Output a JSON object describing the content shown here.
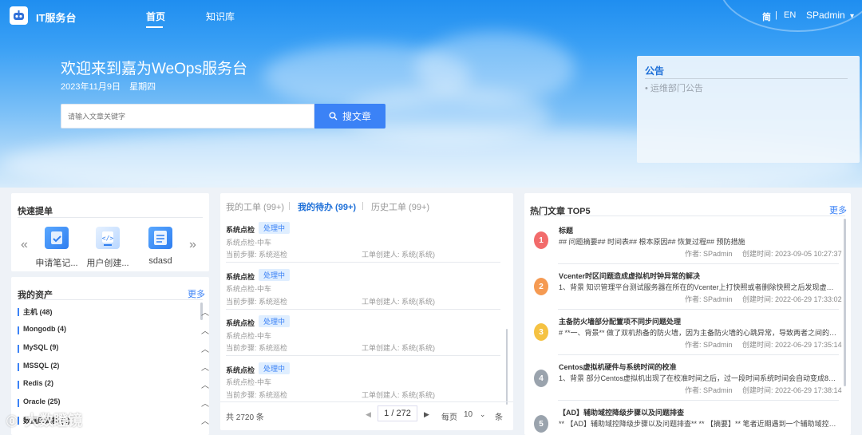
{
  "app": {
    "title": "IT服务台"
  },
  "nav": {
    "items": [
      {
        "label": "首页"
      },
      {
        "label": "知识库"
      }
    ]
  },
  "lang": {
    "zh": "简",
    "sep": "|",
    "en": "EN"
  },
  "user": {
    "name": "SPadmin",
    "caret": "▾"
  },
  "hero": {
    "welcome": "欢迎来到嘉为WeOps服务台",
    "date": "2023年11月9日",
    "weekday": "星期四",
    "search_placeholder": "请输入文章关键字",
    "search_button": "搜文章"
  },
  "notice": {
    "title": "公告",
    "items": [
      "• 运维部门公告"
    ]
  },
  "quick": {
    "title": "快速提单",
    "prev": "«",
    "next": "»",
    "items": [
      {
        "label": "申请笔记..."
      },
      {
        "label": "用户创建..."
      },
      {
        "label": "sdasd"
      }
    ]
  },
  "assets": {
    "title": "我的资产",
    "more": "更多",
    "items": [
      {
        "label": "主机 (48)"
      },
      {
        "label": "Mongodb (4)"
      },
      {
        "label": "MySQL (9)"
      },
      {
        "label": "MSSQL (2)"
      },
      {
        "label": "Redis (2)"
      },
      {
        "label": "Oracle (25)"
      },
      {
        "label": "数据库集群 (1)"
      }
    ]
  },
  "tasks": {
    "tabs": [
      {
        "label": "我的工单 (99+)"
      },
      {
        "label": "我的待办 (99+)"
      },
      {
        "label": "历史工单 (99+)"
      }
    ],
    "items": [
      {
        "name": "系统点检",
        "status": "处理中",
        "type": "系统点检-中车",
        "step": "当前步骤: 系统巡检",
        "creator": "工单创建人: 系统(系统)"
      },
      {
        "name": "系统点检",
        "status": "处理中",
        "type": "系统点检-中车",
        "step": "当前步骤: 系统巡检",
        "creator": "工单创建人: 系统(系统)"
      },
      {
        "name": "系统点检",
        "status": "处理中",
        "type": "系统点检-中车",
        "step": "当前步骤: 系统巡检",
        "creator": "工单创建人: 系统(系统)"
      },
      {
        "name": "系统点检",
        "status": "处理中",
        "type": "系统点检-中车",
        "step": "当前步骤: 系统巡检",
        "creator": "工单创建人: 系统(系统)"
      }
    ],
    "pager": {
      "total": "共 2720 条",
      "prev": "◀",
      "page": "1 / 272",
      "next": "▶",
      "per_page_label": "每页",
      "per_page": "10",
      "unit": "条"
    }
  },
  "hot": {
    "title": "热门文章 TOP5",
    "more": "更多",
    "items": [
      {
        "rank": "1",
        "title": "标题",
        "desc": "## 问题摘要## 时间表## 根本原因## 恢复过程## 预防措施",
        "author": "作者: SPadmin",
        "time": "创建时间: 2023-09-05 10:27:37",
        "color": "#f26b6b"
      },
      {
        "rank": "2",
        "title": "Vcenter时区问题造成虚拟机时钟异常的解决",
        "desc": "1、背景 知识管理平台测试服务器在所在的Vcenter上打快照或者删除快照之后发现虚拟机系...",
        "author": "作者: SPadmin",
        "time": "创建时间: 2022-06-29 17:33:02",
        "color": "#f59a52"
      },
      {
        "rank": "3",
        "title": "主备防火墙部分配置项不同步问题处理",
        "desc": "# **一、背景** 做了双机热备的防火墙，因为主备防火墙的心跳异常，导致两者之间的部分...",
        "author": "作者: SPadmin",
        "time": "创建时间: 2022-06-29 17:35:14",
        "color": "#f5c242"
      },
      {
        "rank": "4",
        "title": "Centos虚拟机硬件与系统时间的校准",
        "desc": "1、背景 部分Centos虚拟机出现了在校准时间之后，过一段时间系统时间会自动变成8小时之...",
        "author": "作者: SPadmin",
        "time": "创建时间: 2022-06-29 17:38:14",
        "color": "#9aa3ad"
      },
      {
        "rank": "5",
        "title": "【AD】辅助域控降级步骤以及问题排查",
        "desc": "** 【AD】辅助域控降级步骤以及问题排查** ** 【摘要】** 笔者近期遇到一个辅助域控无法正...",
        "author": "",
        "time": "",
        "color": "#9aa3ad"
      }
    ]
  },
  "watermark": {
    "text": "大数瞪镜"
  }
}
